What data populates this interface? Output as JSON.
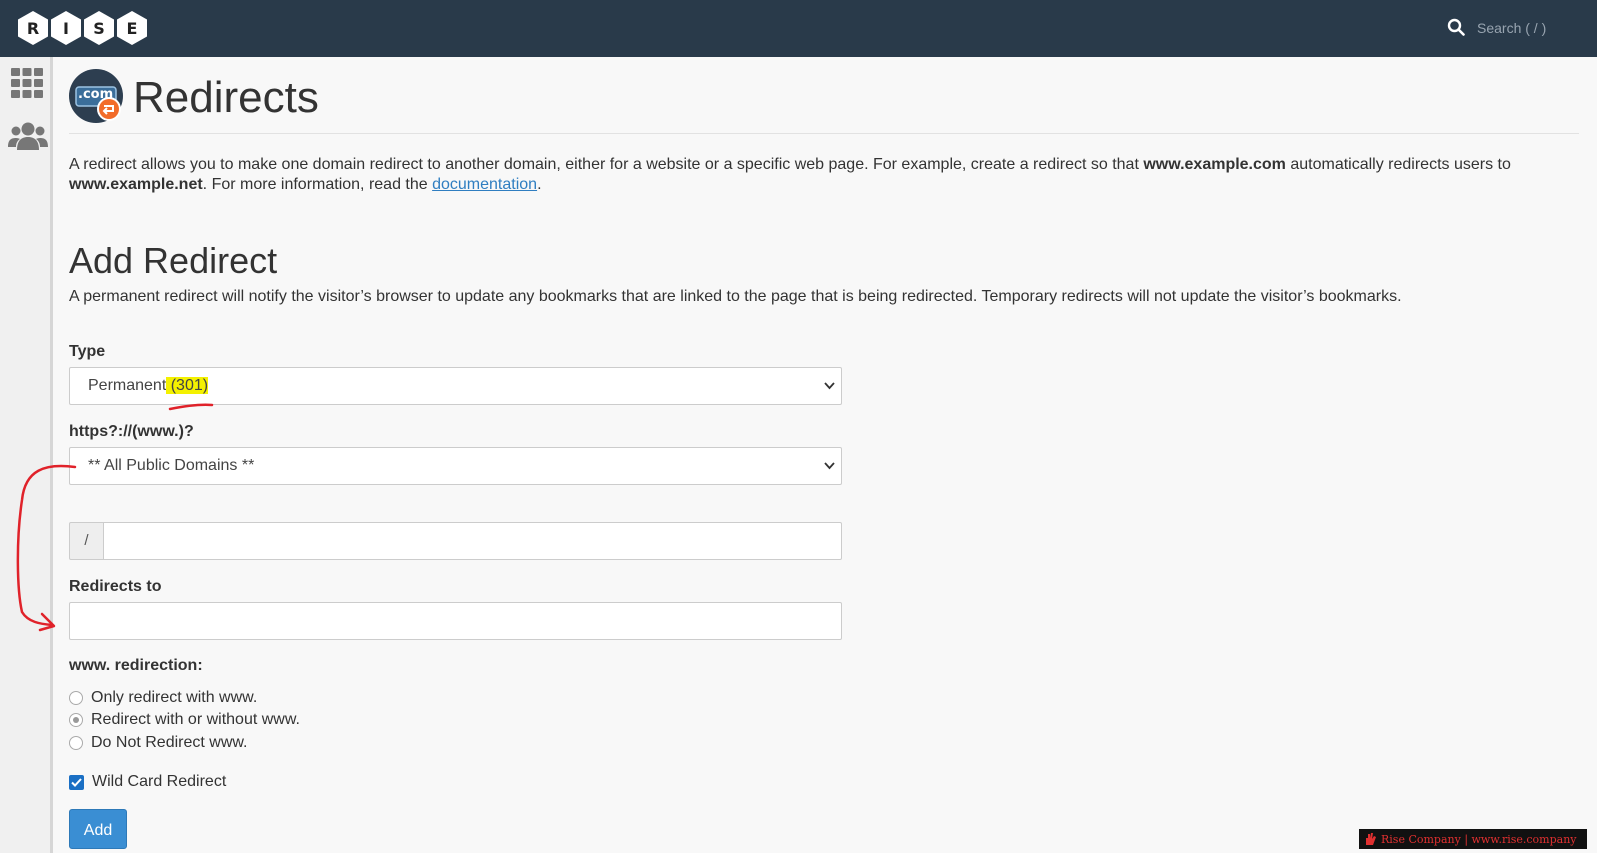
{
  "topbar": {
    "logo_letters": [
      "R",
      "I",
      "S",
      "E"
    ],
    "search_placeholder": "Search ( / )"
  },
  "sidebar": {
    "icons": [
      "apps-grid-icon",
      "users-icon"
    ]
  },
  "page": {
    "app_icon_text": ".com",
    "title": "Redirects",
    "intro_part1": "A redirect allows you to make one domain redirect to another domain, either for a website or a specific web page. For example, create a redirect so that ",
    "intro_bold1": "www.example.com",
    "intro_part2": " automatically redirects users to ",
    "intro_bold2": "www.example.net",
    "intro_part3": ". For more information, read the ",
    "intro_link": "documentation",
    "intro_end": "."
  },
  "form": {
    "section_title": "Add Redirect",
    "section_desc": "A permanent redirect will notify the visitor’s browser to update any bookmarks that are linked to the page that is being redirected. Temporary redirects will not update the visitor’s bookmarks.",
    "type_label": "Type",
    "type_value_prefix": "Permanent",
    "type_value_highlight": " (301)",
    "domain_label": "https?://(www.)?",
    "domain_value": "** All Public Domains **",
    "path_addon": "/",
    "path_value": "",
    "redirects_to_label": "Redirects to",
    "redirects_to_value": "",
    "www_label": "www. redirection:",
    "www_options": [
      {
        "label": "Only redirect with www.",
        "checked": false
      },
      {
        "label": "Redirect with or without www.",
        "checked": true
      },
      {
        "label": "Do Not Redirect www.",
        "checked": false
      }
    ],
    "wildcard_label": "Wild Card Redirect",
    "wildcard_checked": true,
    "add_button": "Add"
  },
  "watermark": {
    "text": "Rise Company | www.rise.company"
  },
  "colors": {
    "topbar": "#293a4a",
    "accent": "#3a8ed3",
    "link": "#2f7ec1",
    "highlight": "#f4f100",
    "annotation": "#e0222a"
  }
}
